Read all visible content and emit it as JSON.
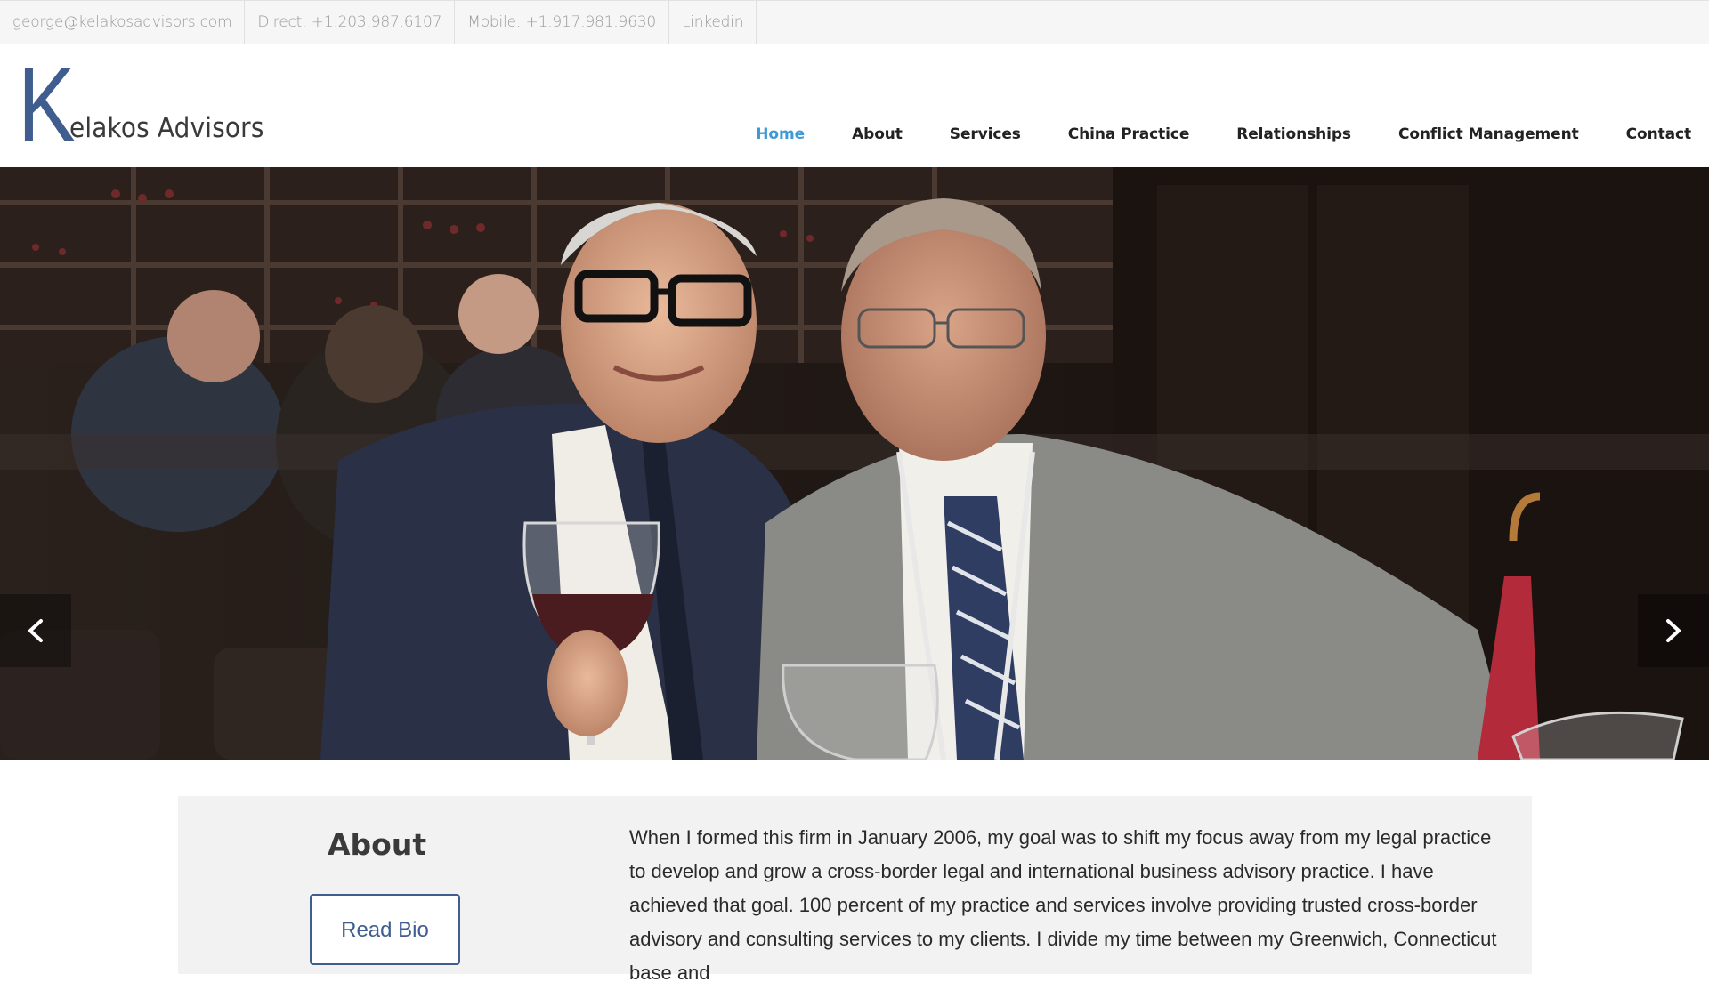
{
  "topbar": {
    "email": "george@kelakosadvisors.com",
    "direct": "Direct: +1.203.987.6107",
    "mobile": "Mobile: +1.917.981.9630",
    "linkedin": "Linkedin"
  },
  "logo": {
    "letter": "K",
    "rest": "elakos Advisors"
  },
  "nav": {
    "items": [
      "Home",
      "About",
      "Services",
      "China Practice",
      "Relationships",
      "Conflict Management",
      "Contact"
    ],
    "active": "Home"
  },
  "hero": {
    "prev_icon": "chevron-left-icon",
    "next_icon": "chevron-right-icon"
  },
  "about": {
    "heading": "About",
    "button": "Read Bio",
    "text": "When I formed this firm in January 2006, my goal was to shift my focus away from my legal practice to develop and grow a cross-border legal and international business advisory practice. I have achieved that goal.  100 percent of my practice and services involve providing trusted cross-border advisory and consulting services to my clients.  I divide my time between my Greenwich, Connecticut base and"
  },
  "colors": {
    "accent": "#3e9ad6",
    "brand": "#3f5e8f",
    "topbar_bg": "#f6f6f6",
    "about_bg": "#f2f2f2"
  }
}
